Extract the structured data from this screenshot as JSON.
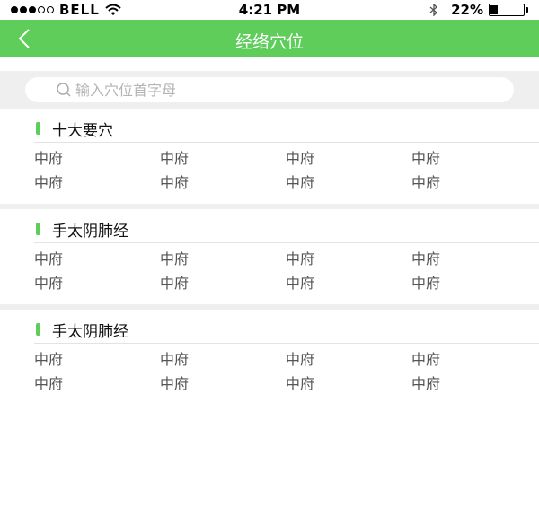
{
  "status_bar": {
    "carrier": "BELL",
    "time": "4:21 PM",
    "battery_text": "22%",
    "battery_level": 0.22,
    "signal_dots_filled": 3,
    "signal_dots_total": 5
  },
  "nav": {
    "title": "经络穴位",
    "accent_color": "#5fcd5a"
  },
  "search": {
    "placeholder": "输入穴位首字母",
    "value": ""
  },
  "sections": [
    {
      "title": "十大要穴",
      "items": [
        "中府",
        "中府",
        "中府",
        "中府",
        "中府",
        "中府",
        "中府",
        "中府"
      ]
    },
    {
      "title": "手太阴肺经",
      "items": [
        "中府",
        "中府",
        "中府",
        "中府",
        "中府",
        "中府",
        "中府",
        "中府"
      ]
    },
    {
      "title": "手太阴肺经",
      "items": [
        "中府",
        "中府",
        "中府",
        "中府",
        "中府",
        "中府",
        "中府",
        "中府"
      ]
    }
  ],
  "icons": {
    "back": "chevron-left-icon",
    "search": "search-icon",
    "wifi": "wifi-icon",
    "bluetooth": "bluetooth-icon",
    "battery": "battery-icon"
  }
}
